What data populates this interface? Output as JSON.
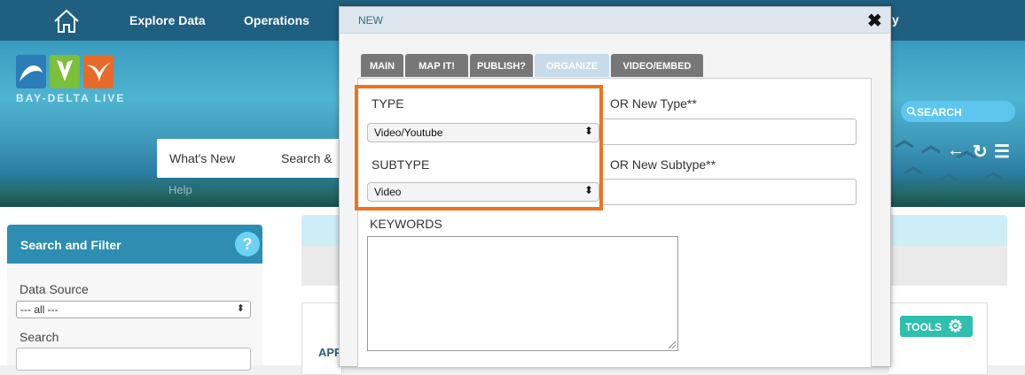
{
  "topnav": {
    "items": [
      "Explore Data",
      "Operations"
    ],
    "trailing_fragment": "y"
  },
  "hero": {
    "logo_text": "BAY-DELTA LIVE",
    "search_label": "SEARCH"
  },
  "subnav": {
    "items": [
      "What's New",
      "Search &"
    ],
    "ghost_text": "Help"
  },
  "sidebar": {
    "header": "Search and Filter",
    "help_icon_text": "?",
    "data_source_label": "Data Source",
    "data_source_value": "--- all ---",
    "search_label": "Search"
  },
  "content": {
    "partial_text": "APP",
    "tools_label": "TOOLS"
  },
  "modal": {
    "title": "NEW",
    "close_glyph": "✖",
    "tabs": [
      {
        "label": "MAIN",
        "active": false
      },
      {
        "label": "MAP IT!",
        "active": false
      },
      {
        "label": "PUBLISH?",
        "active": false
      },
      {
        "label": "ORGANIZE",
        "active": true
      },
      {
        "label": "VIDEO/EMBED",
        "active": false
      }
    ],
    "form": {
      "type_label": "TYPE",
      "type_value": "Video/Youtube",
      "new_type_label": "OR New Type**",
      "new_type_value": "",
      "subtype_label": "SUBTYPE",
      "subtype_value": "Video",
      "new_subtype_label": "OR New Subtype**",
      "new_subtype_value": "",
      "keywords_label": "KEYWORDS",
      "keywords_value": ""
    },
    "select_arrow_glyph": "⬍"
  },
  "colors": {
    "nav_bg": "#1f5f80",
    "highlight": "#f0731e",
    "tab_active": "#c7dbea",
    "tab_inactive": "#777777",
    "tools_btn": "#2fbfae"
  },
  "icons": [
    "home-icon",
    "search-icon",
    "back-arrow-icon",
    "refresh-icon",
    "list-icon",
    "help-icon",
    "gear-icon",
    "close-icon",
    "select-arrow-icon",
    "resize-grip-icon"
  ]
}
